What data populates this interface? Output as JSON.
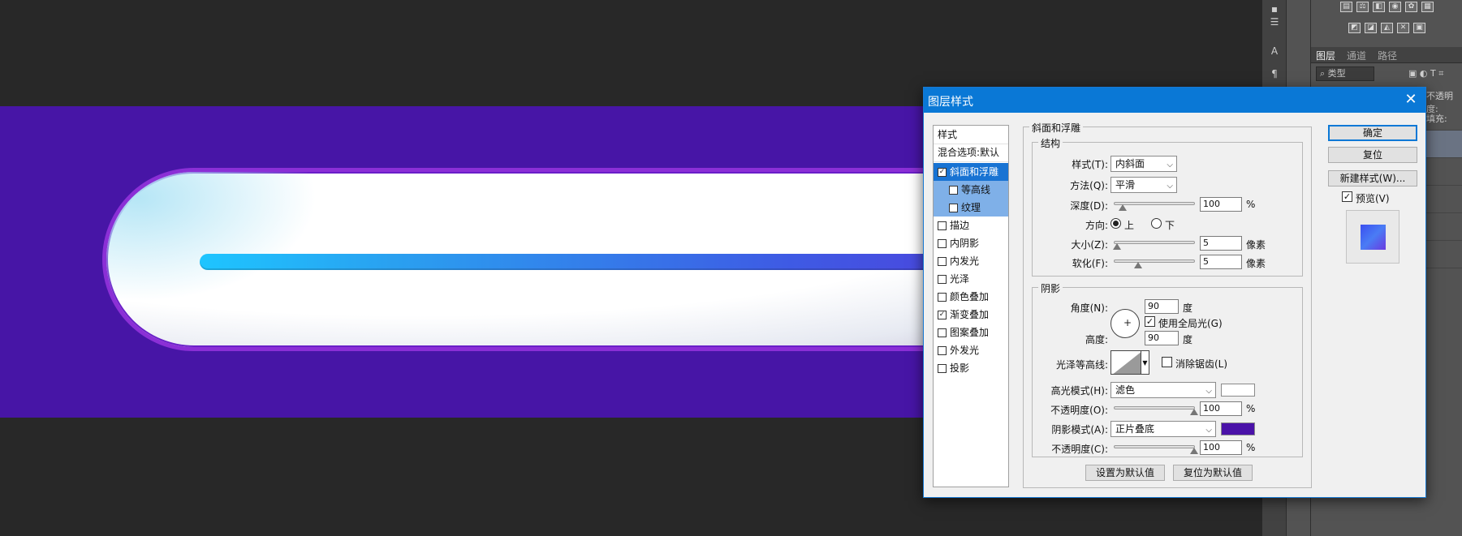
{
  "canvas": {
    "background_color": "#4715a6",
    "pill_border_color": "#8b2fd6",
    "progress_gradient": [
      "#1ec5ff",
      "#3e5be4",
      "#5a2fd6"
    ]
  },
  "right_panel": {
    "layer_tabs": [
      "图层",
      "通道",
      "路径"
    ],
    "filter_label": "类型",
    "opacity_label": "不透明度:",
    "fill_label": "填充:"
  },
  "dialog": {
    "title": "图层样式",
    "styles_list": {
      "header": "样式",
      "blend_options": "混合选项:默认",
      "items": [
        {
          "label": "斜面和浮雕",
          "checked": true,
          "selected": true,
          "sub": false
        },
        {
          "label": "等高线",
          "checked": false,
          "selected": false,
          "sub": true
        },
        {
          "label": "纹理",
          "checked": false,
          "selected": false,
          "sub": true
        },
        {
          "label": "描边",
          "checked": false,
          "selected": false,
          "sub": false
        },
        {
          "label": "内阴影",
          "checked": false,
          "selected": false,
          "sub": false
        },
        {
          "label": "内发光",
          "checked": false,
          "selected": false,
          "sub": false
        },
        {
          "label": "光泽",
          "checked": false,
          "selected": false,
          "sub": false
        },
        {
          "label": "颜色叠加",
          "checked": false,
          "selected": false,
          "sub": false
        },
        {
          "label": "渐变叠加",
          "checked": true,
          "selected": false,
          "sub": false
        },
        {
          "label": "图案叠加",
          "checked": false,
          "selected": false,
          "sub": false
        },
        {
          "label": "外发光",
          "checked": false,
          "selected": false,
          "sub": false
        },
        {
          "label": "投影",
          "checked": false,
          "selected": false,
          "sub": false
        }
      ]
    },
    "bevel": {
      "group_title": "斜面和浮雕",
      "structure": {
        "title": "结构",
        "style_label": "样式(T):",
        "style_value": "内斜面",
        "technique_label": "方法(Q):",
        "technique_value": "平滑",
        "depth_label": "深度(D):",
        "depth_value": "100",
        "depth_unit": "%",
        "depth_fraction": 0.1,
        "direction_label": "方向:",
        "dir_up": "上",
        "dir_down": "下",
        "size_label": "大小(Z):",
        "size_value": "5",
        "size_unit": "像素",
        "size_fraction": 0.03,
        "soften_label": "软化(F):",
        "soften_value": "5",
        "soften_unit": "像素",
        "soften_fraction": 0.3
      },
      "shading": {
        "title": "阴影",
        "angle_label": "角度(N):",
        "angle_value": "90",
        "angle_unit": "度",
        "global_light_label": "使用全局光(G)",
        "altitude_label": "高度:",
        "altitude_value": "90",
        "altitude_unit": "度",
        "gloss_contour_label": "光泽等高线:",
        "anti_alias_label": "消除锯齿(L)",
        "highlight_mode_label": "高光模式(H):",
        "highlight_mode_value": "滤色",
        "highlight_color": "#ffffff",
        "highlight_opacity_label": "不透明度(O):",
        "highlight_opacity_value": "100",
        "highlight_opacity_unit": "%",
        "shadow_mode_label": "阴影模式(A):",
        "shadow_mode_value": "正片叠底",
        "shadow_color": "#4a12a8",
        "shadow_opacity_label": "不透明度(C):",
        "shadow_opacity_value": "100",
        "shadow_opacity_unit": "%"
      },
      "make_default": "设置为默认值",
      "reset_default": "复位为默认值"
    },
    "buttons": {
      "ok": "确定",
      "reset": "复位",
      "new_style": "新建样式(W)...",
      "preview_label": "预览(V)"
    }
  }
}
